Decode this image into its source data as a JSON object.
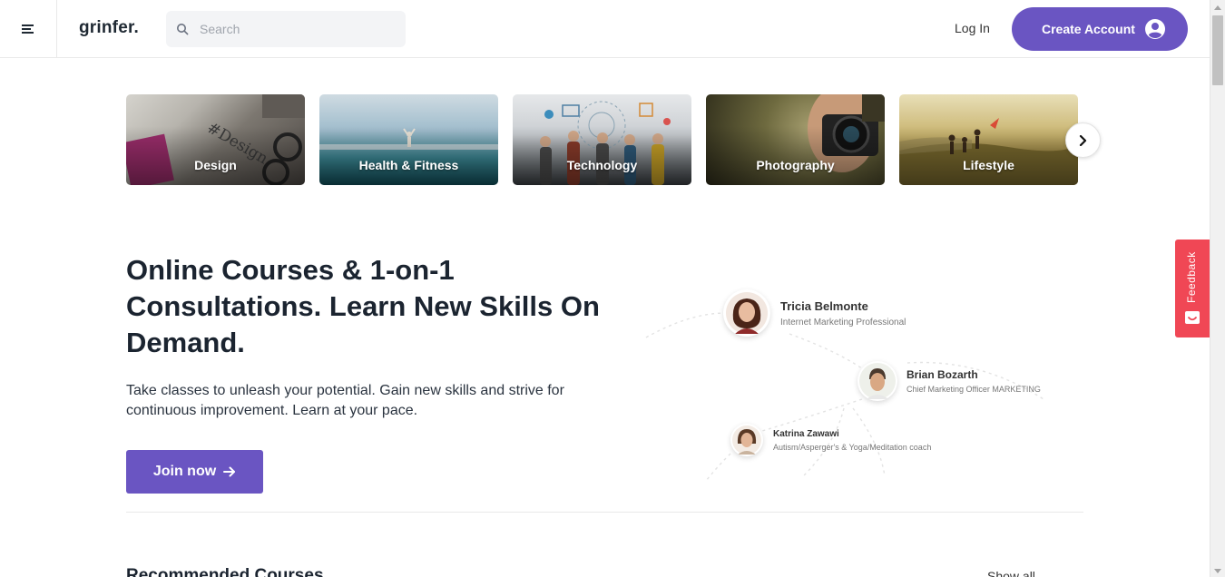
{
  "header": {
    "logo": "grinfer.",
    "search_placeholder": "Search",
    "login_label": "Log In",
    "create_account_label": "Create Account"
  },
  "categories": [
    {
      "label": "Design"
    },
    {
      "label": "Health & Fitness"
    },
    {
      "label": "Technology"
    },
    {
      "label": "Photography"
    },
    {
      "label": "Lifestyle"
    }
  ],
  "hero": {
    "title": "Online Courses & 1-on-1 Consultations. Learn New Skills On Demand.",
    "description": "Take classes to unleash your potential. Gain new skills and strive for continuous improvement. Learn at your pace.",
    "cta_label": "Join now"
  },
  "experts": [
    {
      "name": "Tricia Belmonte",
      "role": "Internet Marketing Professional"
    },
    {
      "name": "Brian Bozarth",
      "role": "Chief Marketing Officer MARKETING"
    },
    {
      "name": "Katrina Zawawi",
      "role": "Autism/Asperger's & Yoga/Meditation coach"
    }
  ],
  "recommended": {
    "title": "Recommended Courses",
    "show_all": "Show all"
  },
  "feedback": {
    "label": "Feedback"
  },
  "colors": {
    "accent": "#6a55c2",
    "feedback": "#f04755",
    "text": "#1b2430"
  }
}
